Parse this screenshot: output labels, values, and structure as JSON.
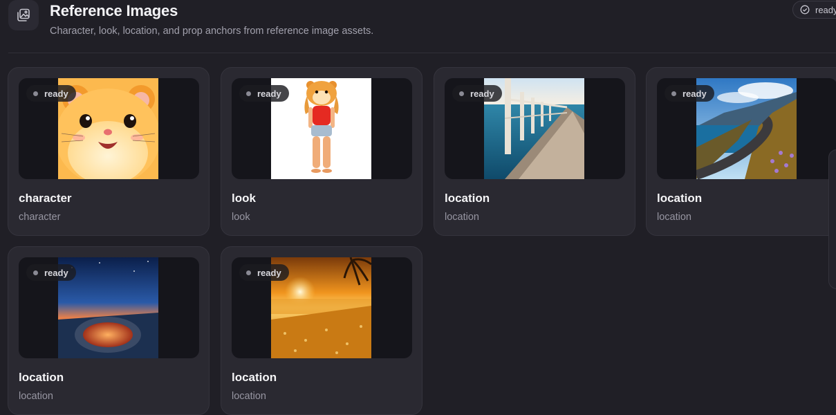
{
  "header": {
    "title": "Reference Images",
    "subtitle": "Character, look, location, and prop anchors from reference image assets.",
    "icon": "image-gallery-icon",
    "status": "ready",
    "status_icon": "check-circle-icon"
  },
  "cards": [
    {
      "badge": "ready",
      "title": "character",
      "subtitle": "character",
      "image": "hamster-face"
    },
    {
      "badge": "ready",
      "title": "look",
      "subtitle": "look",
      "image": "hamster-character-standing"
    },
    {
      "badge": "ready",
      "title": "location",
      "subtitle": "location",
      "image": "seaside-pier"
    },
    {
      "badge": "ready",
      "title": "location",
      "subtitle": "location",
      "image": "coastal-road"
    },
    {
      "badge": "ready",
      "title": "location",
      "subtitle": "location",
      "image": "night-sky-fire-pit"
    },
    {
      "badge": "ready",
      "title": "location",
      "subtitle": "location",
      "image": "sunset-beach"
    }
  ],
  "colors": {
    "background": "#201f26",
    "card": "#2a2931",
    "thumb_bg": "#15151b",
    "muted_text": "#9796a2"
  }
}
